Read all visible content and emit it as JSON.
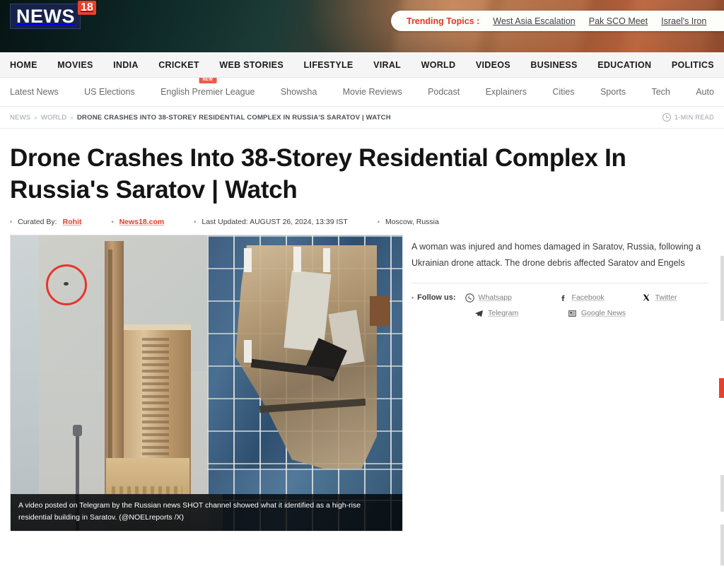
{
  "site": {
    "logo_primary": "NEWS",
    "logo_badge": "18"
  },
  "trending": {
    "label": "Trending Topics :",
    "items": [
      "West Asia Escalation",
      "Pak SCO Meet",
      "Israel's Iron"
    ]
  },
  "primary_nav": {
    "items": [
      "HOME",
      "MOVIES",
      "INDIA",
      "CRICKET",
      "WEB STORIES",
      "LIFESTYLE",
      "VIRAL",
      "WORLD",
      "VIDEOS",
      "BUSINESS",
      "EDUCATION",
      "POLITICS"
    ]
  },
  "secondary_nav": {
    "badge_label": "NEW",
    "items": [
      "Latest News",
      "US Elections",
      "English Premier League",
      "Showsha",
      "Movie Reviews",
      "Podcast",
      "Explainers",
      "Cities",
      "Sports",
      "Tech",
      "Auto"
    ]
  },
  "breadcrumb": {
    "items": [
      "NEWS",
      "WORLD"
    ],
    "separator": "»",
    "current": "DRONE CRASHES INTO 38-STOREY RESIDENTIAL COMPLEX IN RUSSIA'S SARATOV | WATCH"
  },
  "read_time": "1-MIN READ",
  "article": {
    "headline": "Drone Crashes Into 38-Storey Residential Complex In Russia's Saratov | Watch",
    "curated_by_label": "Curated By:",
    "author": "Rohit",
    "source": "News18.com",
    "last_updated": "Last Updated: AUGUST 26, 2024, 13:39 IST",
    "dateline": "Moscow, Russia",
    "summary": "A woman was injured and homes damaged in Saratov, Russia, following a Ukrainian drone attack. The drone debris affected Saratov and Engels",
    "image_caption": "A video posted on Telegram by the Russian news SHOT channel showed what it identified as a high-rise residential building in Saratov. (@NOELreports /X)"
  },
  "follow": {
    "label": "Follow us:",
    "links": [
      {
        "name": "Whatsapp",
        "icon": "whatsapp-icon"
      },
      {
        "name": "Facebook",
        "icon": "facebook-icon"
      },
      {
        "name": "Twitter",
        "icon": "twitter-x-icon"
      },
      {
        "name": "Telegram",
        "icon": "telegram-icon"
      },
      {
        "name": "Google News",
        "icon": "google-news-icon"
      }
    ]
  },
  "colors": {
    "brand_red": "#e8402a",
    "logo_navy": "#17224a",
    "trending_red": "#e03a26",
    "text_dark": "#141414"
  }
}
